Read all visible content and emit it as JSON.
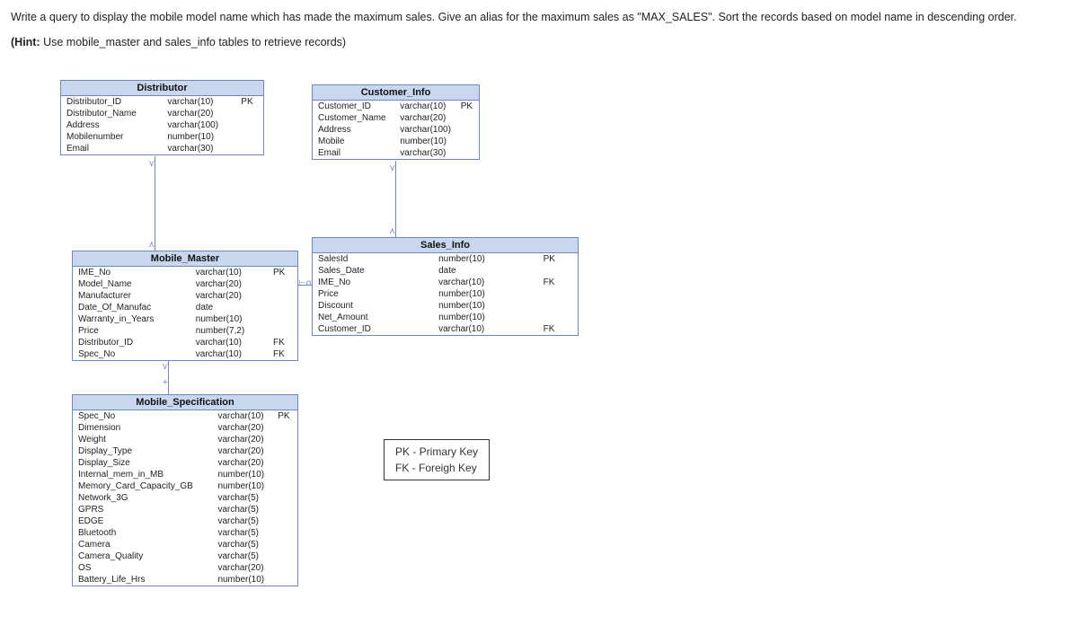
{
  "question": "Write a query to display the mobile  model name which has made the maximum sales. Give an alias for the maximum sales as \"MAX_SALES\". Sort the records based on model name in descending order.",
  "hint_prefix": "(Hint:",
  "hint_body": " Use mobile_master and sales_info tables to retrieve records)",
  "legend": {
    "pk": "PK - Primary Key",
    "fk": "FK - Foreigh Key"
  },
  "entities": {
    "distributor": {
      "title": "Distributor",
      "cols": [
        {
          "name": "Distributor_ID",
          "type": "varchar(10)",
          "key": "PK"
        },
        {
          "name": "Distributor_Name",
          "type": "varchar(20)",
          "key": ""
        },
        {
          "name": "Address",
          "type": "varchar(100)",
          "key": ""
        },
        {
          "name": "Mobilenumber",
          "type": "number(10)",
          "key": ""
        },
        {
          "name": "Email",
          "type": "varchar(30)",
          "key": ""
        }
      ]
    },
    "customer": {
      "title": "Customer_Info",
      "cols": [
        {
          "name": "Customer_ID",
          "type": "varchar(10)",
          "key": "PK"
        },
        {
          "name": "Customer_Name",
          "type": "varchar(20)",
          "key": ""
        },
        {
          "name": "Address",
          "type": "varchar(100)",
          "key": ""
        },
        {
          "name": "Mobile",
          "type": "number(10)",
          "key": ""
        },
        {
          "name": "Email",
          "type": "varchar(30)",
          "key": ""
        }
      ]
    },
    "mobilemaster": {
      "title": "Mobile_Master",
      "cols": [
        {
          "name": "IME_No",
          "type": "varchar(10)",
          "key": "PK"
        },
        {
          "name": "Model_Name",
          "type": "varchar(20)",
          "key": ""
        },
        {
          "name": "Manufacturer",
          "type": "varchar(20)",
          "key": ""
        },
        {
          "name": "Date_Of_Manufac",
          "type": "date",
          "key": ""
        },
        {
          "name": "Warranty_in_Years",
          "type": "number(10)",
          "key": ""
        },
        {
          "name": "Price",
          "type": "number(7,2)",
          "key": ""
        },
        {
          "name": "Distributor_ID",
          "type": "varchar(10)",
          "key": "FK"
        },
        {
          "name": "Spec_No",
          "type": "varchar(10)",
          "key": "FK"
        }
      ]
    },
    "salesinfo": {
      "title": "Sales_Info",
      "cols": [
        {
          "name": "SalesId",
          "type": "number(10)",
          "key": "PK"
        },
        {
          "name": "Sales_Date",
          "type": "date",
          "key": ""
        },
        {
          "name": "IME_No",
          "type": "varchar(10)",
          "key": "FK"
        },
        {
          "name": "Price",
          "type": "number(10)",
          "key": ""
        },
        {
          "name": "Discount",
          "type": "number(10)",
          "key": ""
        },
        {
          "name": "Net_Amount",
          "type": "number(10)",
          "key": ""
        },
        {
          "name": "Customer_ID",
          "type": "varchar(10)",
          "key": "FK"
        }
      ]
    },
    "mobilespec": {
      "title": "Mobile_Specification",
      "cols": [
        {
          "name": "Spec_No",
          "type": "varchar(10)",
          "key": "PK"
        },
        {
          "name": "Dimension",
          "type": "varchar(20)",
          "key": ""
        },
        {
          "name": "Weight",
          "type": "varchar(20)",
          "key": ""
        },
        {
          "name": "Display_Type",
          "type": "varchar(20)",
          "key": ""
        },
        {
          "name": "Display_Size",
          "type": "varchar(20)",
          "key": ""
        },
        {
          "name": "Internal_mem_in_MB",
          "type": "number(10)",
          "key": ""
        },
        {
          "name": "Memory_Card_Capacity_GB",
          "type": "number(10)",
          "key": ""
        },
        {
          "name": "Network_3G",
          "type": "varchar(5)",
          "key": ""
        },
        {
          "name": "GPRS",
          "type": "varchar(5)",
          "key": ""
        },
        {
          "name": "EDGE",
          "type": "varchar(5)",
          "key": ""
        },
        {
          "name": "Bluetooth",
          "type": "varchar(5)",
          "key": ""
        },
        {
          "name": "Camera",
          "type": "varchar(5)",
          "key": ""
        },
        {
          "name": "Camera_Quality",
          "type": "varchar(5)",
          "key": ""
        },
        {
          "name": "OS",
          "type": "varchar(20)",
          "key": ""
        },
        {
          "name": "Battery_Life_Hrs",
          "type": "number(10)",
          "key": ""
        }
      ]
    }
  }
}
